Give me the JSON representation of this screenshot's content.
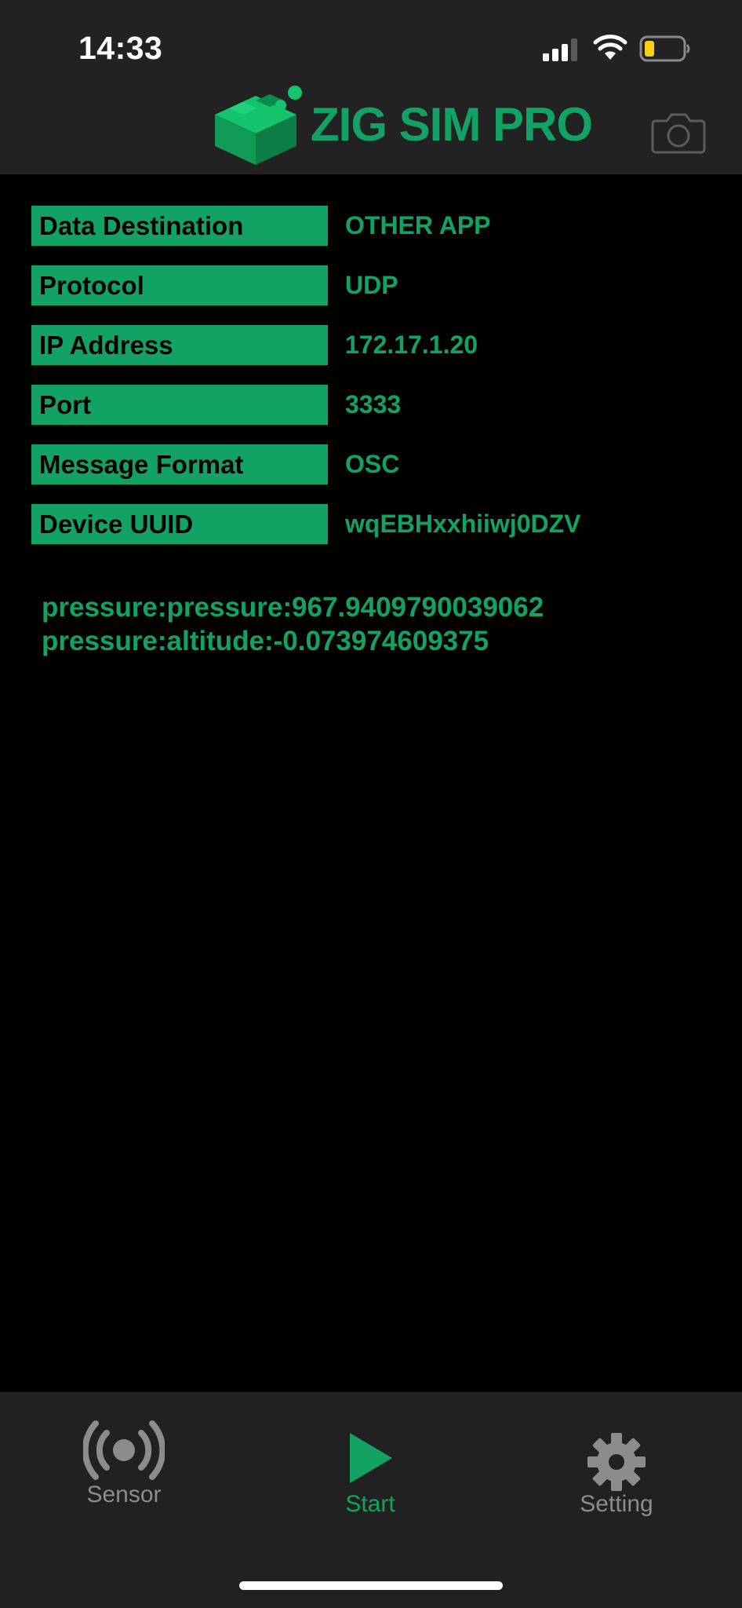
{
  "status_bar": {
    "time": "14:33"
  },
  "header": {
    "app_name": "ZIG SIM PRO",
    "camera_icon": "camera-icon"
  },
  "info": [
    {
      "key": "Data Destination",
      "value": "OTHER APP"
    },
    {
      "key": "Protocol",
      "value": "UDP"
    },
    {
      "key": "IP Address",
      "value": "172.17.1.20"
    },
    {
      "key": "Port",
      "value": "3333"
    },
    {
      "key": "Message Format",
      "value": "OSC"
    },
    {
      "key": "Device UUID",
      "value": "wqEBHxxhiiwj0DZV"
    }
  ],
  "readings": [
    "pressure:pressure:967.9409790039062",
    "pressure:altitude:-0.073974609375"
  ],
  "tabs": {
    "sensor": {
      "label": "Sensor",
      "icon": "broadcast-icon"
    },
    "start": {
      "label": "Start",
      "icon": "play-icon"
    },
    "setting": {
      "label": "Setting",
      "icon": "gear-icon"
    }
  },
  "colors": {
    "accent": "#12a263",
    "bar_background": "#222222",
    "background": "#000000",
    "inactive_tab": "#8c8c8c"
  }
}
